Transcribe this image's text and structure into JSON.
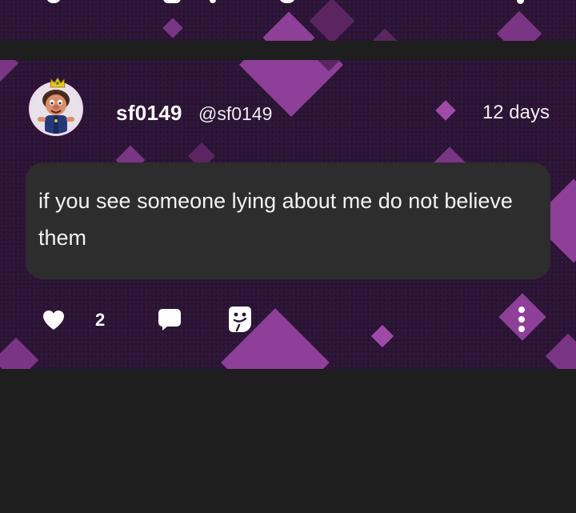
{
  "post": {
    "author_name": "sf0149",
    "author_handle": "@sf0149",
    "timestamp": "12 days",
    "text": "if you see someone lying about me do not believe them",
    "like_count": "2"
  },
  "icons": {
    "like": "heart-icon",
    "comment": "comment-bubble-icon",
    "reply": "reply-sticker-icon",
    "more": "more-vertical-icon"
  },
  "colors": {
    "background": "#1e1e1e",
    "post_background": "#2c1436",
    "bubble": "#2d2d2d",
    "accent_purple": "#8e3f97",
    "avatar_ring": "#f1d7ef"
  }
}
